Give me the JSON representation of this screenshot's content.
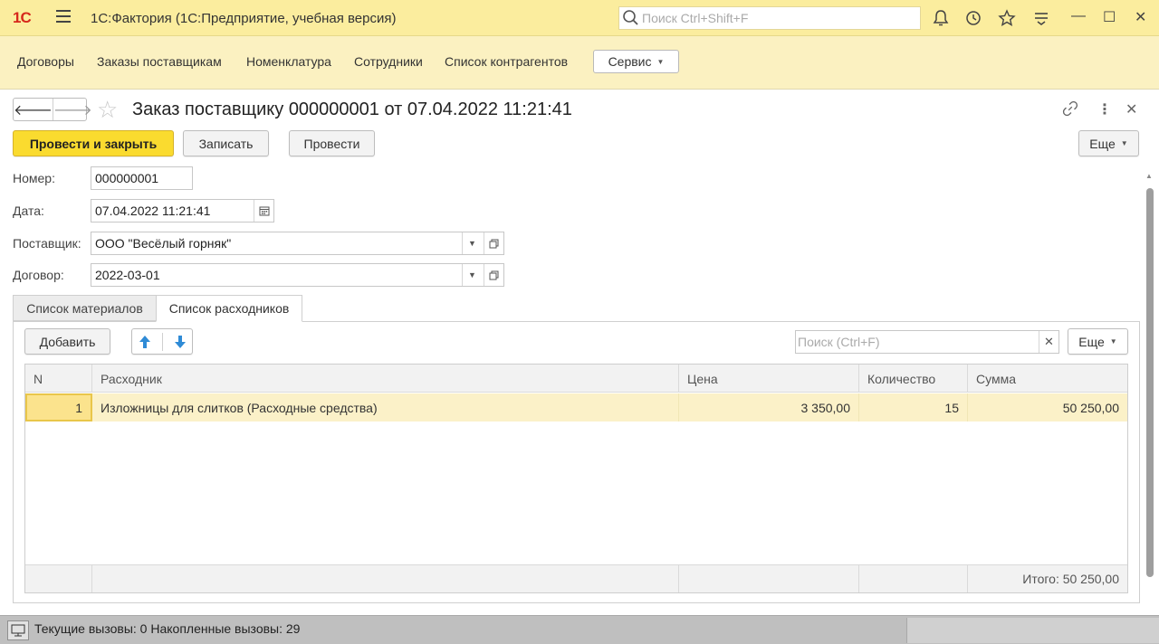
{
  "titlebar": {
    "logo": "1С",
    "app_title": "1С:Фактория  (1С:Предприятие, учебная версия)",
    "search_placeholder": "Поиск Ctrl+Shift+F"
  },
  "sections": {
    "items": [
      "Договоры",
      "Заказы поставщикам",
      "Номенклатура",
      "Сотрудники",
      "Список контрагентов"
    ],
    "service_label": "Сервис"
  },
  "form": {
    "title": "Заказ поставщику 000000001 от 07.04.2022 11:21:41",
    "commands": {
      "post_close": "Провести и закрыть",
      "save": "Записать",
      "post": "Провести",
      "more": "Еще"
    },
    "fields": {
      "number_label": "Номер:",
      "number_value": "000000001",
      "date_label": "Дата:",
      "date_value": "07.04.2022 11:21:41",
      "supplier_label": "Поставщик:",
      "supplier_value": "ООО \"Весёлый горняк\"",
      "contract_label": "Договор:",
      "contract_value": "2022-03-01"
    },
    "tabs": [
      "Список материалов",
      "Список расходников"
    ],
    "table_toolbar": {
      "add": "Добавить",
      "search_placeholder": "Поиск (Ctrl+F)",
      "more": "Еще"
    },
    "table": {
      "columns": [
        "N",
        "Расходник",
        "Цена",
        "Количество",
        "Сумма"
      ],
      "rows": [
        {
          "n": "1",
          "item": "Изложницы для слитков (Расходные средства)",
          "price": "3 350,00",
          "qty": "15",
          "sum": "50 250,00"
        }
      ],
      "total": "Итого: 50 250,00"
    }
  },
  "statusbar": {
    "text": "Текущие вызовы: 0   Накопленные вызовы: 29"
  },
  "colors": {
    "title_bg": "#fbed9e",
    "section_bg": "#fbf1c1",
    "primary_button": "#fadb2f",
    "selected_row": "#fbf1c8"
  }
}
